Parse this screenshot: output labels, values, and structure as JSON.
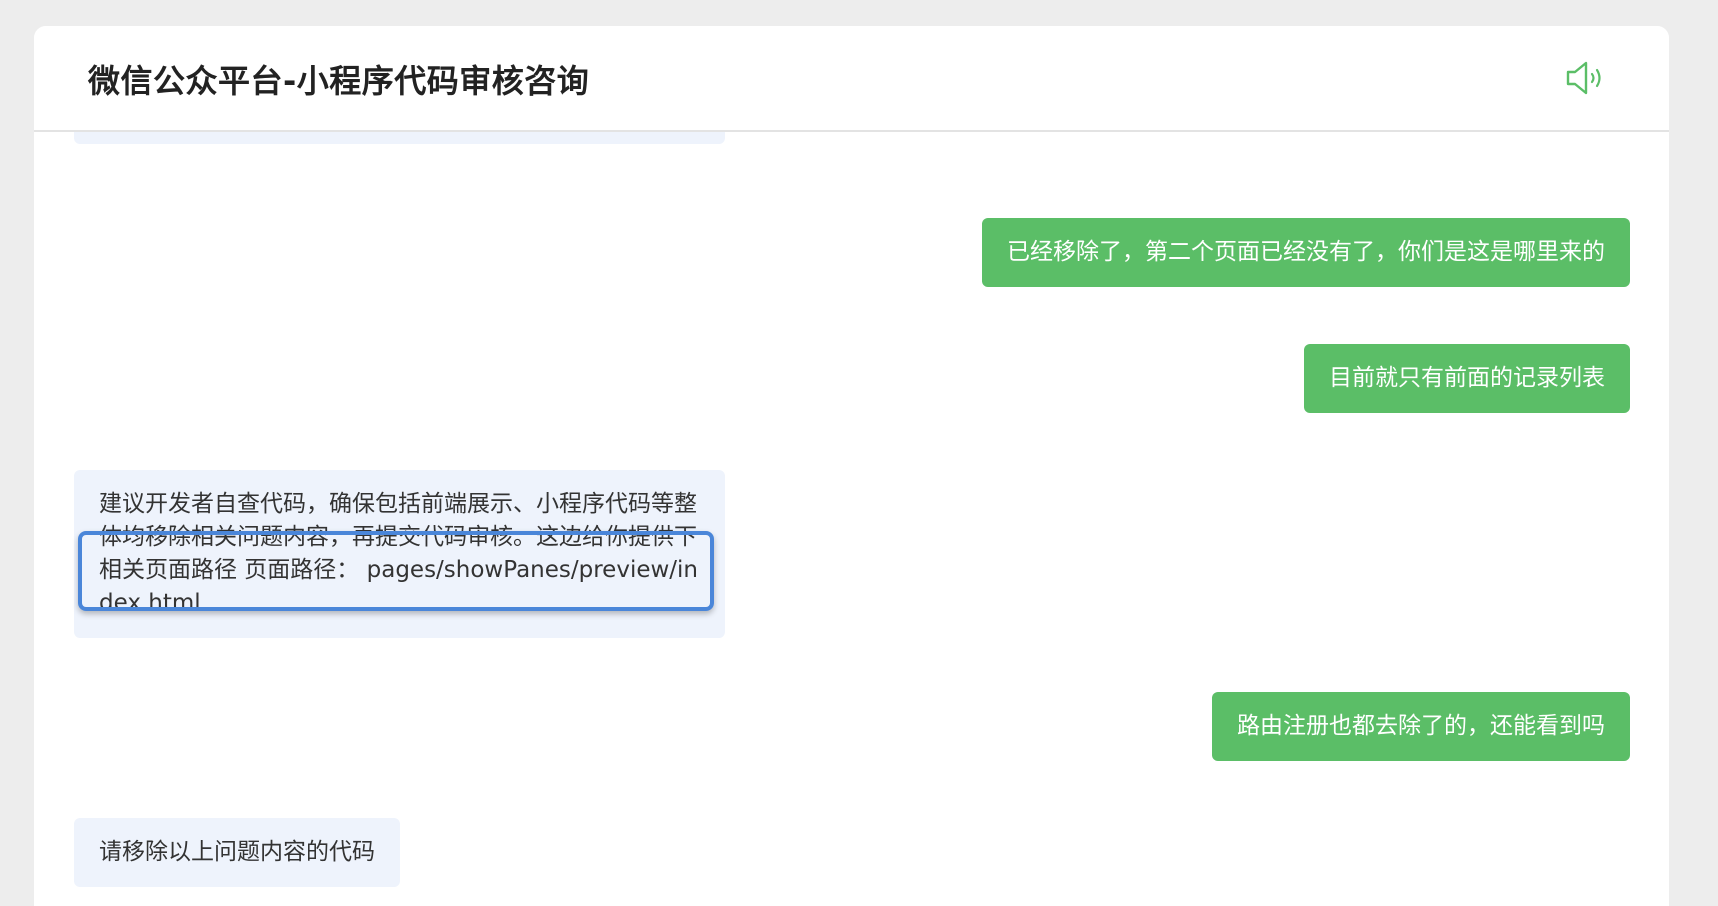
{
  "header": {
    "title": "微信公众平台-小程序代码审核咨询",
    "speaker_icon": "speaker-icon",
    "accent_color": "#5bbe67"
  },
  "messages": [
    {
      "side": "mine",
      "text": "已经移除了，第二个页面已经没有了，你们是这是哪里来的"
    },
    {
      "side": "mine",
      "text": "目前就只有前面的记录列表"
    },
    {
      "side": "theirs",
      "text": "建议开发者自查代码，确保包括前端展示、小程序代码等整体均移除相关问题内容，再提交代码审核。这边给你提供下相关页面路径 页面路径： pages/showPanes/preview/index.html"
    },
    {
      "side": "mine",
      "text": "路由注册也都去除了的，还能看到吗"
    },
    {
      "side": "theirs",
      "text": "请移除以上问题内容的代码"
    }
  ],
  "colors": {
    "mine_bubble": "#5bbe67",
    "theirs_bubble": "#eef3fc",
    "highlight_border": "#4a86d9"
  }
}
